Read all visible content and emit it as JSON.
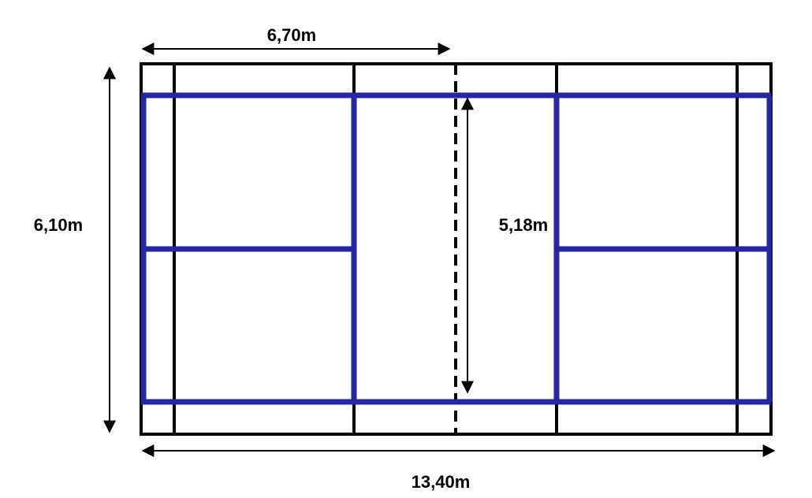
{
  "diagram": {
    "labels": {
      "half_length": "6,70m",
      "doubles_width": "6,10m",
      "singles_width": "5,18m",
      "full_length": "13,40m"
    },
    "colors": {
      "doubles_outline": "#000000",
      "singles_lines": "#2626a0",
      "arrows": "#000000",
      "background": "#ffffff"
    },
    "net_style": "dashed"
  }
}
